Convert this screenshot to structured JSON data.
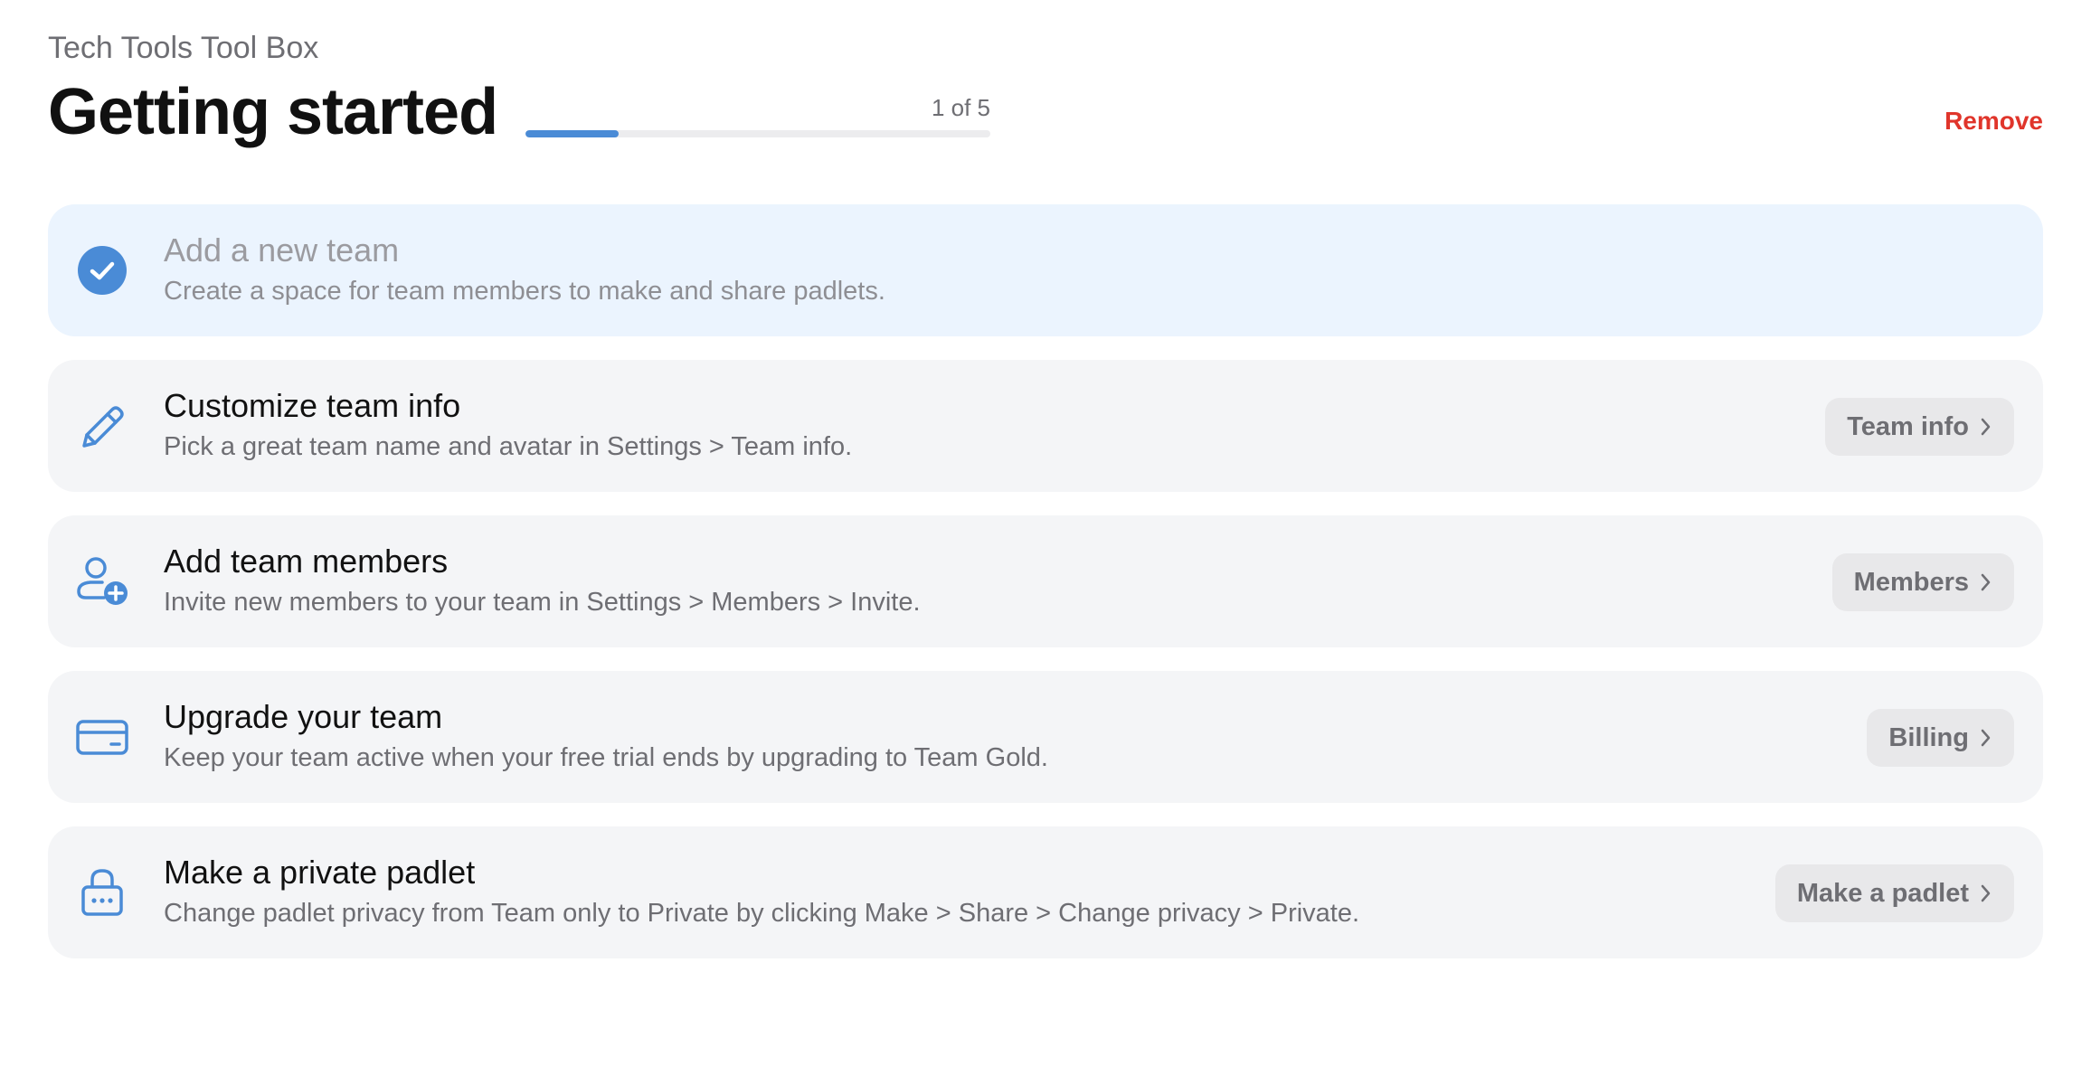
{
  "team_name": "Tech Tools Tool Box",
  "page_title": "Getting started",
  "progress": {
    "label": "1 of 5",
    "completed": 1,
    "total": 5
  },
  "remove_label": "Remove",
  "colors": {
    "accent": "#4a8bd6",
    "remove": "#e0352b",
    "done_background": "#ebf4fe",
    "step_background": "#f4f5f7"
  },
  "steps": [
    {
      "icon": "check-circle-icon",
      "title": "Add a new team",
      "description": "Create a space for team members to make and share padlets.",
      "completed": true
    },
    {
      "icon": "pencil-icon",
      "title": "Customize team info",
      "description": "Pick a great team name and avatar in Settings > Team info.",
      "button": "Team info"
    },
    {
      "icon": "add-user-icon",
      "title": "Add team members",
      "description": "Invite new members to your team in Settings > Members > Invite.",
      "button": "Members"
    },
    {
      "icon": "credit-card-icon",
      "title": "Upgrade your team",
      "description": "Keep your team active when your free trial ends by upgrading to Team Gold.",
      "button": "Billing"
    },
    {
      "icon": "lock-icon",
      "title": "Make a private padlet",
      "description": "Change padlet privacy from Team only to Private by clicking Make > Share > Change privacy > Private.",
      "button": "Make a padlet"
    }
  ]
}
